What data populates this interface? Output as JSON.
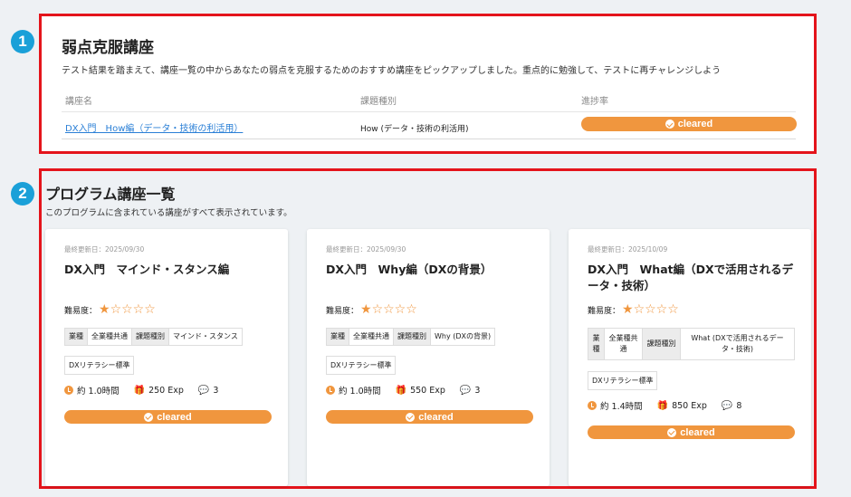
{
  "markers": [
    "1",
    "2"
  ],
  "weak_section": {
    "title": "弱点克服講座",
    "description": "テスト結果を踏まえて、講座一覧の中からあなたの弱点を克服するためのおすすめ講座をピックアップしました。重点的に勉強して、テストに再チャレンジしよう",
    "headers": {
      "course": "講座名",
      "type": "課題種別",
      "progress": "進捗率"
    },
    "rows": [
      {
        "course": "DX入門　How編（データ・技術の利活用）",
        "type": "How (データ・技術の利活用)",
        "progress": "cleared"
      }
    ]
  },
  "program_section": {
    "title": "プログラム講座一覧",
    "description": "このプログラムに含まれている講座がすべて表示されています。",
    "difficulty_label": "難易度：",
    "cards": [
      {
        "updated": "最終更新日：2025/09/30",
        "name": "DX入門　マインド・スタンス編",
        "stars": "★☆☆☆☆",
        "tags": {
          "k1": "業種",
          "v1": "全業種共通",
          "k2": "課題種別",
          "v2": "マインド・スタンス"
        },
        "standard": "DXリテラシー標準",
        "time": "約 1.0時間",
        "exp": "250 Exp",
        "comments": "3",
        "status": "cleared"
      },
      {
        "updated": "最終更新日：2025/09/30",
        "name": "DX入門　Why編（DXの背景）",
        "stars": "★☆☆☆☆",
        "tags": {
          "k1": "業種",
          "v1": "全業種共通",
          "k2": "課題種別",
          "v2": "Why (DXの背景)"
        },
        "standard": "DXリテラシー標準",
        "time": "約 1.0時間",
        "exp": "550 Exp",
        "comments": "3",
        "status": "cleared"
      },
      {
        "updated": "最終更新日：2025/10/09",
        "name": "DX入門　What編（DXで活用されるデータ・技術）",
        "stars": "★☆☆☆☆",
        "tags": {
          "k1": "業種",
          "v1": "全業種共通",
          "k2": "課題種別",
          "v2": "What (DXで活用されるデータ・技術)"
        },
        "standard": "DXリテラシー標準",
        "time": "約 1.4時間",
        "exp": "850 Exp",
        "comments": "8",
        "status": "cleared"
      }
    ]
  },
  "colors": {
    "accent_orange": "#f0963e",
    "marker_blue": "#1aa0d8",
    "highlight_red": "#e4141b",
    "link_blue": "#2a7fd6"
  },
  "icons": {
    "status": "check-circle-icon",
    "time": "clock-icon",
    "exp": "gift-icon",
    "comments": "comments-icon"
  }
}
